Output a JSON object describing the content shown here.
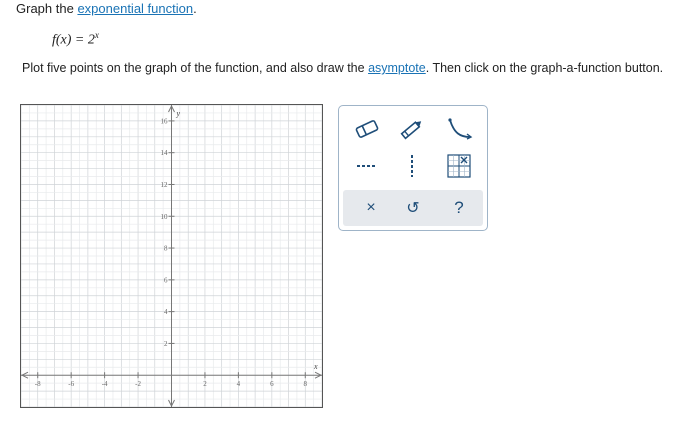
{
  "question": {
    "prefix": "Graph the ",
    "link_text": "exponential function",
    "suffix": "."
  },
  "formula": {
    "lhs": "f(x) = 2",
    "exponent": "x"
  },
  "instructions": {
    "part1": "Plot five points on the graph of the function, and also draw the ",
    "link_text": "asymptote",
    "part2": ". Then click on the graph-a-function button."
  },
  "graph": {
    "x_axis_label": "x",
    "y_axis_label": "y",
    "x_range": [
      -9,
      9
    ],
    "y_range": [
      -2,
      17
    ],
    "x_tick_labels": [
      "-8",
      "-6",
      "-4",
      "-2",
      "2",
      "4",
      "6",
      "8"
    ],
    "y_tick_labels": [
      "2",
      "4",
      "6",
      "8",
      "10",
      "12",
      "14",
      "16"
    ],
    "grid": true
  },
  "toolbox": {
    "tools": [
      {
        "name": "eraser-tool",
        "icon": "eraser-icon"
      },
      {
        "name": "pencil-tool",
        "icon": "pencil-icon"
      },
      {
        "name": "curve-tool",
        "icon": "exponential-curve-icon"
      },
      {
        "name": "dashed-line-tool",
        "icon": "dashed-horizontal-line-icon"
      },
      {
        "name": "vertical-dashed-tool",
        "icon": "dashed-vertical-line-icon"
      },
      {
        "name": "graph-function-tool",
        "icon": "graph-a-function-icon"
      }
    ],
    "actions": {
      "clear_symbol": "×",
      "undo_symbol": "↺",
      "help_symbol": "?"
    },
    "colors": {
      "tool_blue": "#1f4e79",
      "bar_bg": "#e6e9ed",
      "link": "#1a73b5"
    }
  }
}
